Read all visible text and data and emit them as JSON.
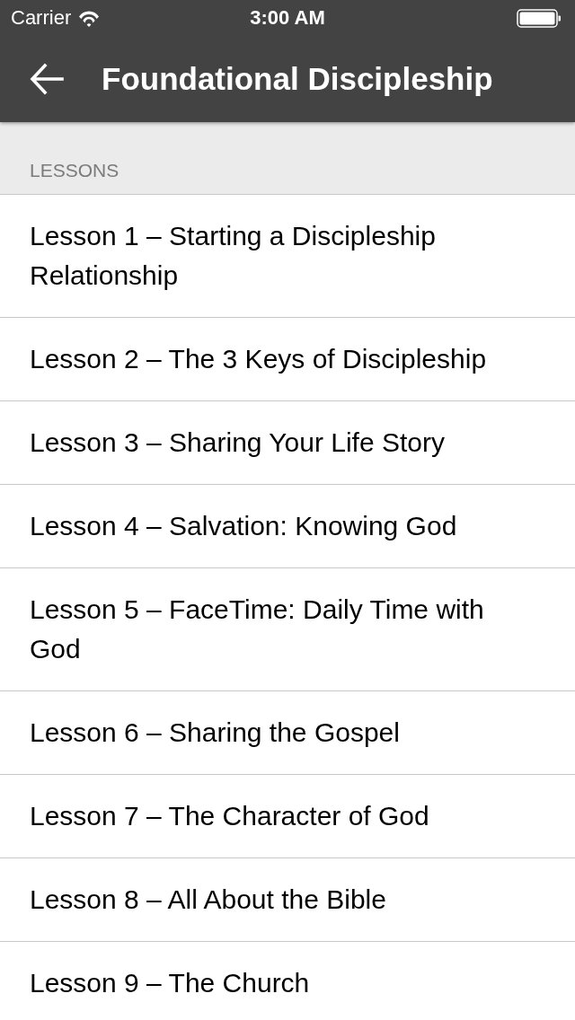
{
  "status_bar": {
    "carrier": "Carrier",
    "time": "3:00 AM"
  },
  "nav_bar": {
    "title": "Foundational Discipleship"
  },
  "section": {
    "header": "LESSONS",
    "lessons": [
      "Lesson 1 – Starting a Discipleship Relationship",
      "Lesson 2 – The 3 Keys of Discipleship",
      "Lesson 3 – Sharing Your Life Story",
      "Lesson 4 – Salvation: Knowing God",
      "Lesson 5 – FaceTime: Daily Time with God",
      "Lesson 6 – Sharing the Gospel",
      "Lesson 7 – The Character of God",
      "Lesson 8 – All About the Bible",
      "Lesson 9 – The Church"
    ]
  }
}
